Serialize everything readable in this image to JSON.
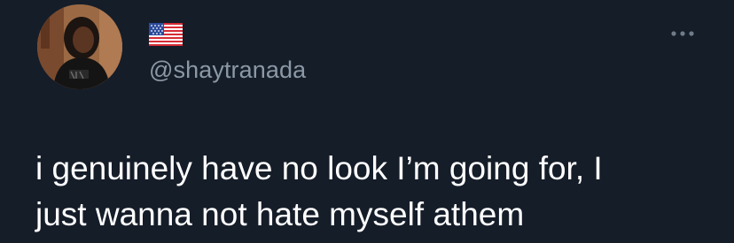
{
  "user": {
    "display_name_icon": "us-flag-emoji",
    "handle": "@shaytranada",
    "avatar_icon": "profile-photo"
  },
  "tweet": {
    "text": "i genuinely have no look I’m going for, I\njust wanna not hate myself athem"
  },
  "controls": {
    "more_icon": "more-options-icon"
  },
  "colors": {
    "background": "#151d29",
    "text": "#ffffff",
    "secondary_text": "#8b98a5"
  }
}
